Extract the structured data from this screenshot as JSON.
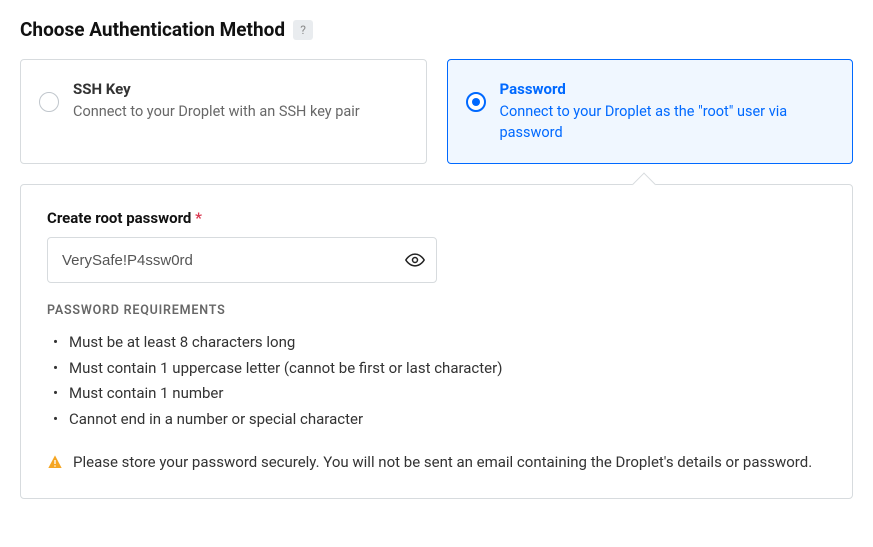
{
  "section": {
    "title": "Choose Authentication Method",
    "help": "?"
  },
  "options": {
    "ssh": {
      "title": "SSH Key",
      "desc": "Connect to your Droplet with an SSH key pair"
    },
    "password": {
      "title": "Password",
      "desc": "Connect to your Droplet as the \"root\" user via password"
    }
  },
  "passwordPanel": {
    "label": "Create root password",
    "required": "*",
    "value": "VerySafe!P4ssw0rd",
    "requirementsHeader": "PASSWORD REQUIREMENTS",
    "requirements": [
      "Must be at least 8 characters long",
      "Must contain 1 uppercase letter (cannot be first or last character)",
      "Must contain 1 number",
      "Cannot end in a number or special character"
    ],
    "warning": "Please store your password securely. You will not be sent an email containing the Droplet's details or password."
  }
}
